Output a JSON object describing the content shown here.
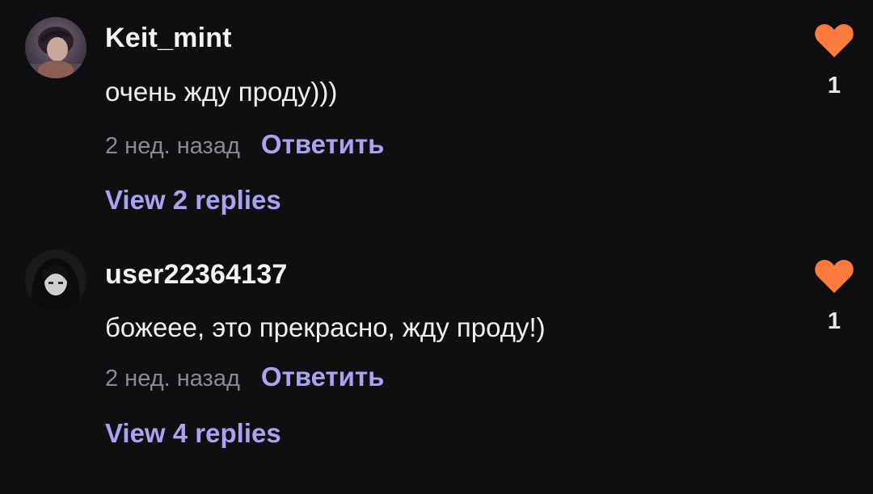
{
  "accent_color": "#a9a3f1",
  "heart_color": "#ff7a3d",
  "comments": [
    {
      "username": "Keit_mint",
      "text": "очень жду проду)))",
      "time": "2 нед. назад",
      "reply_label": "Ответить",
      "view_replies": "View 2 replies",
      "like_count": "1",
      "like_icon": "heart-icon"
    },
    {
      "username": "user22364137",
      "text": "божеее, это прекрасно, жду проду!)",
      "time": "2 нед. назад",
      "reply_label": "Ответить",
      "view_replies": "View 4 replies",
      "like_count": "1",
      "like_icon": "heart-icon"
    }
  ]
}
